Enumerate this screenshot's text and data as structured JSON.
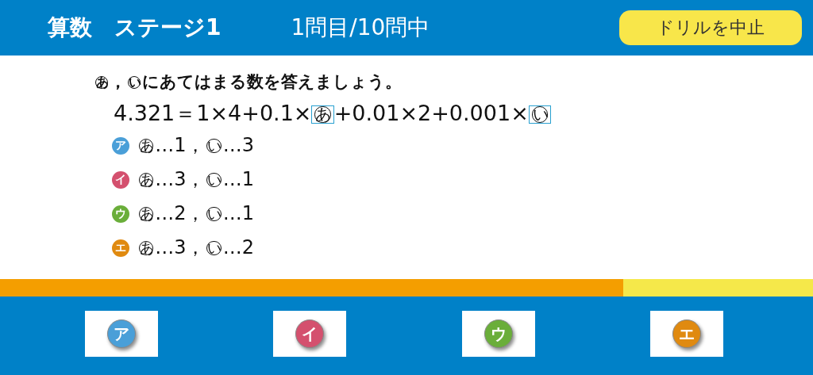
{
  "header": {
    "subject": "算数",
    "stage": "ステージ1",
    "progress": "1問目/10問中",
    "quit_button": "ドリルを中止"
  },
  "question": {
    "prompt": [
      {
        "kind": "circled",
        "text": "あ"
      },
      {
        "kind": "text",
        "text": "，"
      },
      {
        "kind": "circled",
        "text": "い"
      },
      {
        "kind": "text",
        "text": "にあてはまる数を答えましょう。"
      }
    ],
    "equation": [
      {
        "kind": "text",
        "text": "4.321＝1×4+0.1×"
      },
      {
        "kind": "blank",
        "text": "あ"
      },
      {
        "kind": "text",
        "text": "+0.01×2+0.001×"
      },
      {
        "kind": "blank",
        "text": "い"
      }
    ],
    "choices": [
      {
        "label": "ア",
        "color": "#4a9fd8",
        "parts": [
          {
            "kind": "circled",
            "text": "あ"
          },
          {
            "kind": "text",
            "text": "…1，"
          },
          {
            "kind": "circled",
            "text": "い"
          },
          {
            "kind": "text",
            "text": "…3"
          }
        ]
      },
      {
        "label": "イ",
        "color": "#d4506e",
        "parts": [
          {
            "kind": "circled",
            "text": "あ"
          },
          {
            "kind": "text",
            "text": "…3，"
          },
          {
            "kind": "circled",
            "text": "い"
          },
          {
            "kind": "text",
            "text": "…1"
          }
        ]
      },
      {
        "label": "ウ",
        "color": "#6aae3a",
        "parts": [
          {
            "kind": "circled",
            "text": "あ"
          },
          {
            "kind": "text",
            "text": "…2，"
          },
          {
            "kind": "circled",
            "text": "い"
          },
          {
            "kind": "text",
            "text": "…1"
          }
        ]
      },
      {
        "label": "エ",
        "color": "#e08a10",
        "parts": [
          {
            "kind": "circled",
            "text": "あ"
          },
          {
            "kind": "text",
            "text": "…3，"
          },
          {
            "kind": "circled",
            "text": "い"
          },
          {
            "kind": "text",
            "text": "…2"
          }
        ]
      }
    ]
  },
  "timer": {
    "level": 0.767
  },
  "answer_buttons": [
    {
      "label": "ア",
      "color": "#4a9fd8"
    },
    {
      "label": "イ",
      "color": "#d4506e"
    },
    {
      "label": "ウ",
      "color": "#6aae3a"
    },
    {
      "label": "エ",
      "color": "#e08a10"
    }
  ]
}
